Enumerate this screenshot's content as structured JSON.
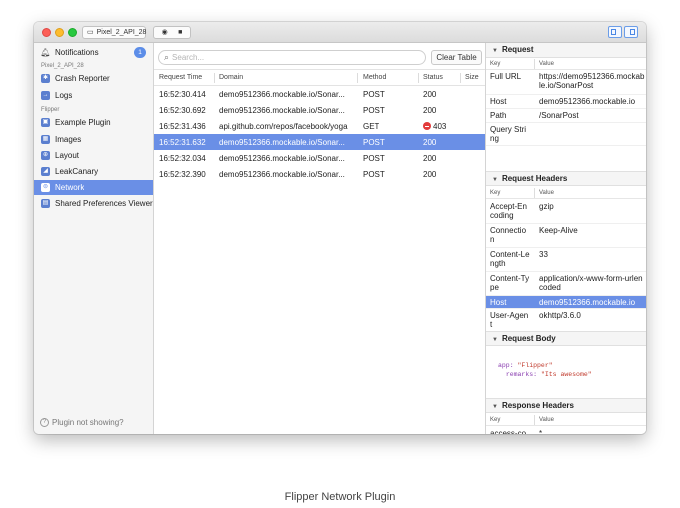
{
  "window": {
    "device": "Pixel_2_API_28"
  },
  "sidebar": {
    "notifications": {
      "label": "Notifications",
      "badge": "1"
    },
    "device_header": "Pixel_2_API_28",
    "items_a": [
      {
        "label": "Crash Reporter",
        "icon": "bug-icon"
      },
      {
        "label": "Logs",
        "icon": "logs-icon"
      }
    ],
    "flipper_header": "Flipper",
    "items_b": [
      {
        "label": "Example Plugin",
        "icon": "plugin-icon"
      },
      {
        "label": "Images",
        "icon": "image-icon"
      },
      {
        "label": "Layout",
        "icon": "layout-icon"
      },
      {
        "label": "LeakCanary",
        "icon": "leak-icon"
      },
      {
        "label": "Network",
        "icon": "network-icon"
      },
      {
        "label": "Shared Preferences Viewer",
        "icon": "prefs-icon"
      }
    ],
    "footer": "Plugin not showing?"
  },
  "main": {
    "search_placeholder": "Search...",
    "clear_button": "Clear Table",
    "columns": [
      "Request Time",
      "Domain",
      "Method",
      "Status",
      "Size"
    ],
    "rows": [
      {
        "time": "16:52:30.414",
        "domain": "demo9512366.mockable.io/Sonar...",
        "method": "POST",
        "status": "200"
      },
      {
        "time": "16:52:30.692",
        "domain": "demo9512366.mockable.io/Sonar...",
        "method": "POST",
        "status": "200"
      },
      {
        "time": "16:52:31.436",
        "domain": "api.github.com/repos/facebook/yoga",
        "method": "GET",
        "status": "403"
      },
      {
        "time": "16:52:31.632",
        "domain": "demo9512366.mockable.io/Sonar...",
        "method": "POST",
        "status": "200"
      },
      {
        "time": "16:52:32.034",
        "domain": "demo9512366.mockable.io/Sonar...",
        "method": "POST",
        "status": "200"
      },
      {
        "time": "16:52:32.390",
        "domain": "demo9512366.mockable.io/Sonar...",
        "method": "POST",
        "status": "200"
      }
    ]
  },
  "detail": {
    "key_header": "Key",
    "value_header": "Value",
    "request": {
      "title": "Request",
      "rows": [
        {
          "k": "Full URL",
          "v": "https://demo9512366.mockable.io/SonarPost"
        },
        {
          "k": "Host",
          "v": "demo9512366.mockable.io"
        },
        {
          "k": "Path",
          "v": "/SonarPost"
        },
        {
          "k": "Query String",
          "v": ""
        }
      ]
    },
    "request_headers": {
      "title": "Request Headers",
      "rows": [
        {
          "k": "Accept-Encoding",
          "v": "gzip"
        },
        {
          "k": "Connection",
          "v": "Keep-Alive"
        },
        {
          "k": "Content-Length",
          "v": "33"
        },
        {
          "k": "Content-Type",
          "v": "application/x-www-form-urlencoded"
        },
        {
          "k": "Host",
          "v": "demo9512366.mockable.io"
        },
        {
          "k": "User-Agent",
          "v": "okhttp/3.6.0"
        }
      ]
    },
    "request_body": {
      "title": "Request Body",
      "app_key": "app:",
      "app_val": "\"Flipper\"",
      "remarks_key": "remarks:",
      "remarks_val": "\"Its awesome\""
    },
    "response_headers": {
      "title": "Response Headers",
      "rows": [
        {
          "k": "access-control-allow",
          "v": "*"
        }
      ]
    }
  },
  "caption": "Flipper Network Plugin"
}
